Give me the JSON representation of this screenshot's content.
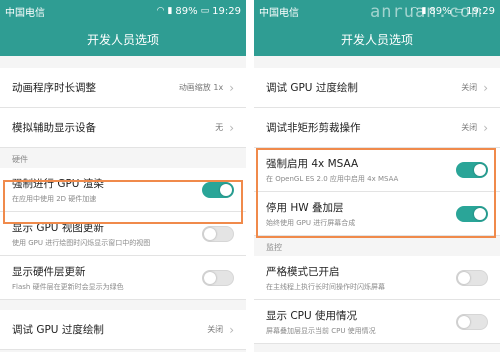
{
  "watermark": "anruan.com",
  "left": {
    "status": {
      "carrier": "中国电信",
      "battery": "89%",
      "time": "19:29"
    },
    "appbar_title": "开发人员选项",
    "items_top": [
      {
        "title": "动画程序时长调整",
        "value": "动画缩放 1x"
      },
      {
        "title": "模拟辅助显示设备",
        "value": "无"
      }
    ],
    "section_hardware": "硬件",
    "item_gpu_force": {
      "title": "强制进行 GPU 渲染",
      "sub": "在应用中使用 2D 硬件加速",
      "toggle_on": true
    },
    "item_gpu_view": {
      "title": "显示 GPU 视图更新",
      "sub": "使用 GPU 进行绘图时闪烁显示窗口中的视图",
      "toggle_on": false
    },
    "item_hw_layers": {
      "title": "显示硬件层更新",
      "sub": "Flash 硬件层在更新时会显示为绿色",
      "toggle_on": false
    },
    "item_gpu_overdraw": {
      "title": "调试 GPU 过度绘制",
      "value": "关闭"
    }
  },
  "right": {
    "status": {
      "carrier": "中国电信",
      "battery": "89%",
      "time": "19:29"
    },
    "appbar_title": "开发人员选项",
    "item_gpu_overdraw": {
      "title": "调试 GPU 过度绘制",
      "value": "关闭"
    },
    "item_nonrect_clip": {
      "title": "调试非矩形剪裁操作",
      "value": "关闭"
    },
    "item_msaa": {
      "title": "强制启用 4x MSAA",
      "sub": "在 OpenGL ES 2.0 应用中启用 4x MSAA",
      "toggle_on": true
    },
    "item_hw_overlay": {
      "title": "停用 HW 叠加层",
      "sub": "始终使用 GPU 进行屏幕合成",
      "toggle_on": true
    },
    "section_monitor": "监控",
    "item_strict": {
      "title": "严格模式已开启",
      "sub": "在主线程上执行长时间操作时闪烁屏幕",
      "toggle_on": false
    },
    "item_cpu": {
      "title": "显示 CPU 使用情况",
      "sub": "屏幕叠加层显示当前 CPU 使用情况",
      "toggle_on": false
    }
  },
  "colors": {
    "appbar": "#2f9d93",
    "toggle_on": "#2aa598",
    "highlight": "#f08a4b"
  },
  "icons": [
    "signal-icon",
    "wifi-icon",
    "battery-icon",
    "chevron-right-icon"
  ]
}
